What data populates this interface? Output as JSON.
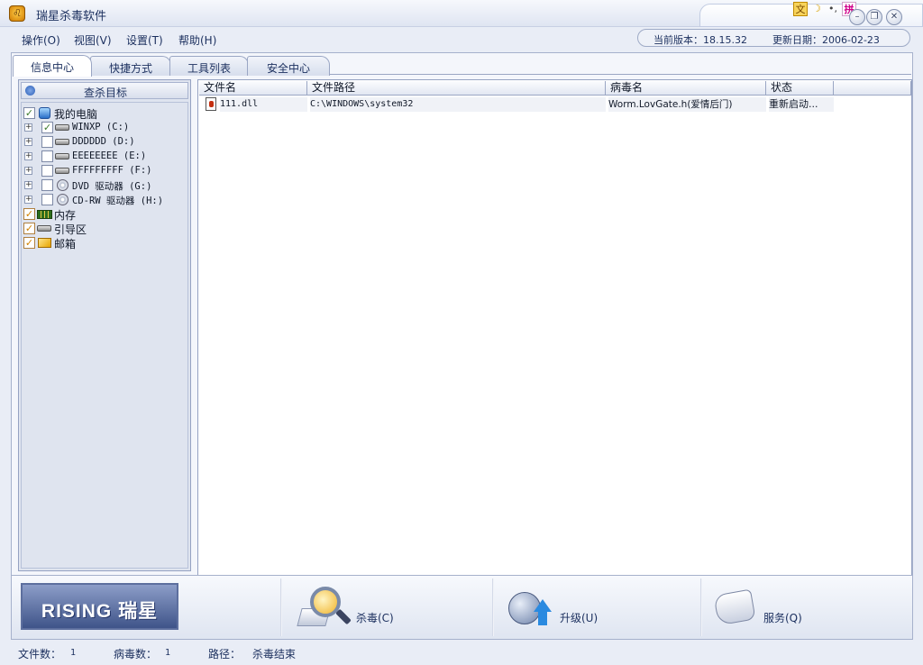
{
  "window": {
    "title": "瑞星杀毒软件",
    "app_icon": "lion-head-icon",
    "ime": [
      "文",
      "☽",
      "•,",
      "拼"
    ],
    "buttons": [
      "minimize",
      "restore",
      "close"
    ]
  },
  "menu": {
    "items": [
      "操作(O)",
      "视图(V)",
      "设置(T)",
      "帮助(H)"
    ]
  },
  "version": {
    "current_label": "当前版本：18.15.32",
    "update_label": "更新日期：2006-02-23"
  },
  "tabs": [
    "信息中心",
    "快捷方式",
    "工具列表",
    "安全中心"
  ],
  "left_panel": {
    "header": "查杀目标",
    "tree": [
      {
        "label": "我的电脑",
        "icon": "computer-icon",
        "checked": "partial",
        "expandable": false
      },
      {
        "label": "WINXP  (C:)",
        "icon": "hard-drive-icon",
        "checked": "partial",
        "expandable": true
      },
      {
        "label": "DDDDDD  (D:)",
        "icon": "hard-drive-icon",
        "checked": "none",
        "expandable": true
      },
      {
        "label": "EEEEEEEE  (E:)",
        "icon": "hard-drive-icon",
        "checked": "none",
        "expandable": true
      },
      {
        "label": "FFFFFFFFF  (F:)",
        "icon": "hard-drive-icon",
        "checked": "none",
        "expandable": true
      },
      {
        "label": "DVD 驱动器  (G:)",
        "icon": "dvd-drive-icon",
        "checked": "none",
        "expandable": true
      },
      {
        "label": "CD-RW 驱动器  (H:)",
        "icon": "cd-drive-icon",
        "checked": "none",
        "expandable": true
      },
      {
        "label": "内存",
        "icon": "memory-icon",
        "checked": "checked",
        "expandable": false
      },
      {
        "label": "引导区",
        "icon": "boot-sector-icon",
        "checked": "checked",
        "expandable": false
      },
      {
        "label": "邮箱",
        "icon": "mailbox-icon",
        "checked": "checked",
        "expandable": false
      }
    ]
  },
  "table": {
    "columns": [
      "文件名",
      "文件路径",
      "病毒名",
      "状态",
      ""
    ],
    "rows": [
      {
        "file": "111.dll",
        "path": "C:\\WINDOWS\\system32",
        "virus": "Worm.LovGate.h(爱情后门)",
        "status": "重新启动..."
      }
    ]
  },
  "actions": {
    "logo": "RISING 瑞星",
    "kill": "杀毒(C)",
    "upgrade": "升级(U)",
    "service": "服务(Q)"
  },
  "status": {
    "files_label": "文件数：",
    "files_value": "1",
    "virus_label": "病毒数：",
    "virus_value": "1",
    "path_label": "路径：",
    "path_value": "杀毒结束"
  }
}
